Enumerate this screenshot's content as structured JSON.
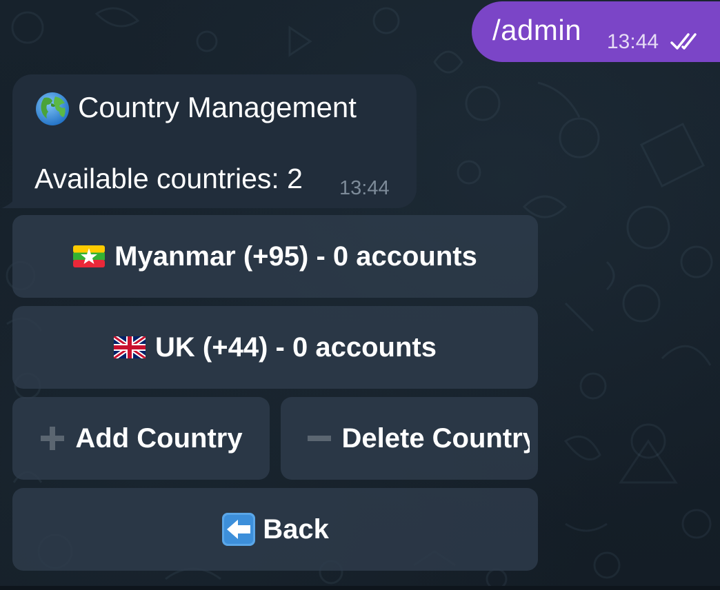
{
  "outgoing": {
    "text": "/admin",
    "time": "13:44",
    "status_icon": "double-check-icon",
    "bubble_color": "#7b45c7"
  },
  "incoming": {
    "title_icon": "globe-icon",
    "title": "Country Management",
    "line2": "Available countries: 2",
    "time": "13:44",
    "bubble_color": "#212d3b"
  },
  "keyboard": {
    "buttons": [
      {
        "icon": "myanmar-flag-icon",
        "label": "Myanmar (+95) - 0 accounts"
      },
      {
        "icon": "uk-flag-icon",
        "label": "UK (+44) - 0 accounts"
      },
      {
        "icon": "plus-icon",
        "label": "Add Country"
      },
      {
        "icon": "minus-icon",
        "label": "Delete Country"
      },
      {
        "icon": "back-arrow-icon",
        "label": "Back"
      }
    ]
  }
}
